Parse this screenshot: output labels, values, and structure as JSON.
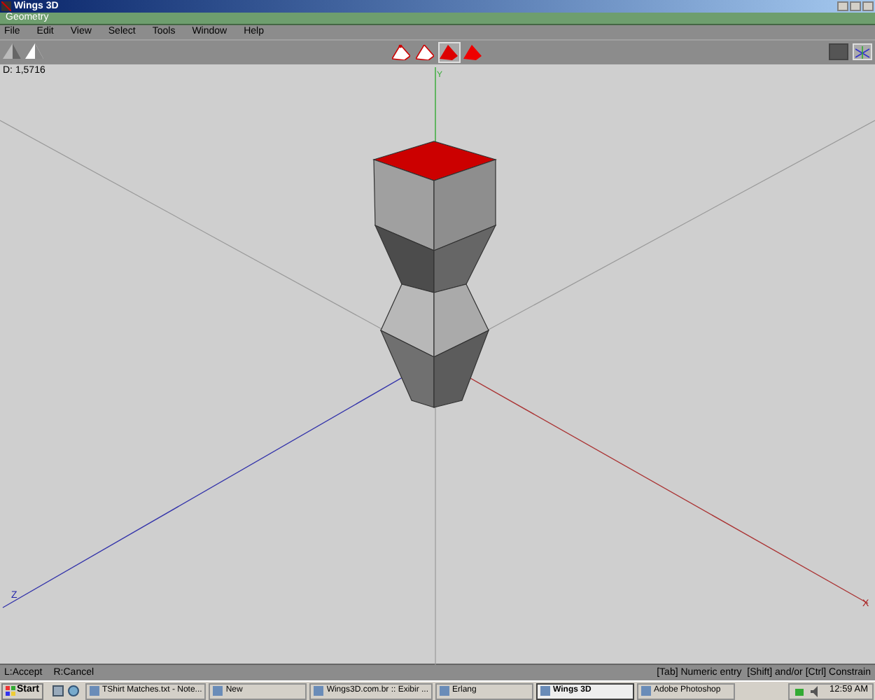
{
  "window": {
    "title": "Wings 3D"
  },
  "geometry_bar": {
    "title": "Geometry"
  },
  "menu": [
    "File",
    "Edit",
    "View",
    "Select",
    "Tools",
    "Window",
    "Help"
  ],
  "selection_modes": [
    {
      "kind": "vertex",
      "selected": false
    },
    {
      "kind": "edge",
      "selected": false
    },
    {
      "kind": "face",
      "selected": true
    },
    {
      "kind": "body",
      "selected": false
    }
  ],
  "viewport": {
    "info": "D: 1,5716",
    "axis_labels": {
      "y": "Y",
      "z": "Z",
      "x": "X"
    }
  },
  "status_bar": {
    "left": [
      "L:Accept",
      "R:Cancel"
    ],
    "right": "[Tab] Numeric entry  [Shift] and/or [Ctrl] Constrain"
  },
  "taskbar": {
    "start": "Start",
    "tasks": [
      {
        "label": "TShirt Matches.txt - Note...",
        "selected": false
      },
      {
        "label": "New",
        "selected": false
      },
      {
        "label": "Wings3D.com.br :: Exibir ...",
        "selected": false
      },
      {
        "label": "Erlang",
        "selected": false
      },
      {
        "label": "Wings 3D",
        "selected": true
      },
      {
        "label": "Adobe Photoshop",
        "selected": false
      }
    ],
    "clock": "12:59 AM"
  }
}
